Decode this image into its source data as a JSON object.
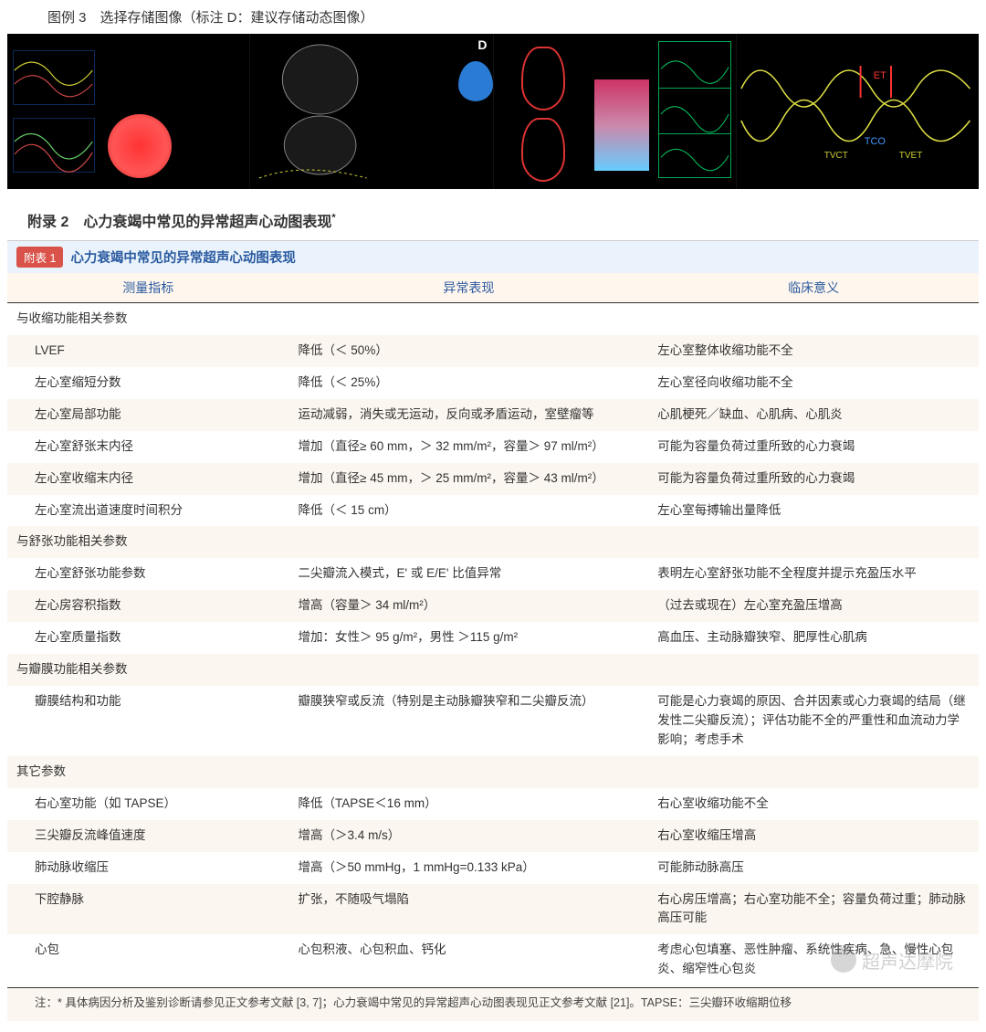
{
  "figure_caption": "图例 3　选择存储图像（标注 D：建议存储动态图像）",
  "panel_d_label": "D",
  "tdi_labels": {
    "et": "ET",
    "tco": "TCO",
    "tvct": "TVCT",
    "tvet": "TVET"
  },
  "appendix_heading": "附录 2　心力衰竭中常见的异常超声心动图表现",
  "appendix_heading_sup": "*",
  "table_badge": "附表 1",
  "table_title": "心力衰竭中常见的异常超声心动图表现",
  "columns": {
    "a": "测量指标",
    "b": "异常表现",
    "c": "临床意义"
  },
  "sections": [
    {
      "title": "与收缩功能相关参数",
      "rows": [
        {
          "a": "LVEF",
          "b": "降低（＜ 50%）",
          "c": "左心室整体收缩功能不全"
        },
        {
          "a": "左心室缩短分数",
          "b": "降低（＜ 25%）",
          "c": "左心室径向收缩功能不全"
        },
        {
          "a": "左心室局部功能",
          "b": "运动减弱，消失或无运动，反向或矛盾运动，室壁瘤等",
          "c": "心肌梗死／缺血、心肌病、心肌炎"
        },
        {
          "a": "左心室舒张末内径",
          "b": "增加（直径≥ 60 mm，＞ 32 mm/m²，容量＞ 97 ml/m²）",
          "c": "可能为容量负荷过重所致的心力衰竭"
        },
        {
          "a": "左心室收缩末内径",
          "b": "增加（直径≥ 45 mm，＞ 25 mm/m²，容量＞ 43 ml/m²）",
          "c": "可能为容量负荷过重所致的心力衰竭"
        },
        {
          "a": "左心室流出道速度时间积分",
          "b": "降低（＜ 15 cm）",
          "c": "左心室每搏输出量降低"
        }
      ]
    },
    {
      "title": "与舒张功能相关参数",
      "rows": [
        {
          "a": "左心室舒张功能参数",
          "b": "二尖瓣流入模式，E' 或 E/E' 比值异常",
          "c": "表明左心室舒张功能不全程度并提示充盈压水平"
        },
        {
          "a": "左心房容积指数",
          "b": "增高（容量＞ 34 ml/m²）",
          "c": "（过去或现在）左心室充盈压增高"
        },
        {
          "a": "左心室质量指数",
          "b": "增加：女性＞ 95 g/m²，男性 ＞115 g/m²",
          "c": "高血压、主动脉瓣狭窄、肥厚性心肌病"
        }
      ]
    },
    {
      "title": "与瓣膜功能相关参数",
      "rows": [
        {
          "a": "瓣膜结构和功能",
          "b": "瓣膜狭窄或反流（特别是主动脉瓣狭窄和二尖瓣反流）",
          "c": "可能是心力衰竭的原因、合并因素或心力衰竭的结局（继发性二尖瓣反流）；评估功能不全的严重性和血流动力学影响；考虑手术"
        }
      ]
    },
    {
      "title": "其它参数",
      "rows": [
        {
          "a": "右心室功能（如 TAPSE）",
          "b": "降低（TAPSE＜16 mm）",
          "c": "右心室收缩功能不全"
        },
        {
          "a": "三尖瓣反流峰值速度",
          "b": "增高（＞3.4 m/s）",
          "c": "右心室收缩压增高"
        },
        {
          "a": "肺动脉收缩压",
          "b": "增高（＞50 mmHg，1 mmHg=0.133 kPa）",
          "c": "可能肺动脉高压"
        },
        {
          "a": "下腔静脉",
          "b": "扩张，不随吸气塌陷",
          "c": "右心房压增高；右心室功能不全；容量负荷过重；肺动脉高压可能"
        },
        {
          "a": "心包",
          "b": "心包积液、心包积血、钙化",
          "c": "考虑心包填塞、恶性肿瘤、系统性疾病、急、慢性心包炎、缩窄性心包炎"
        }
      ]
    }
  ],
  "footnote": "注：* 具体病因分析及鉴别诊断请参见正文参考文献 [3, 7]；心力衰竭中常见的异常超声心动图表现见正文参考文献 [21]。TAPSE：三尖瓣环收缩期位移",
  "watermark": "超声达摩院"
}
